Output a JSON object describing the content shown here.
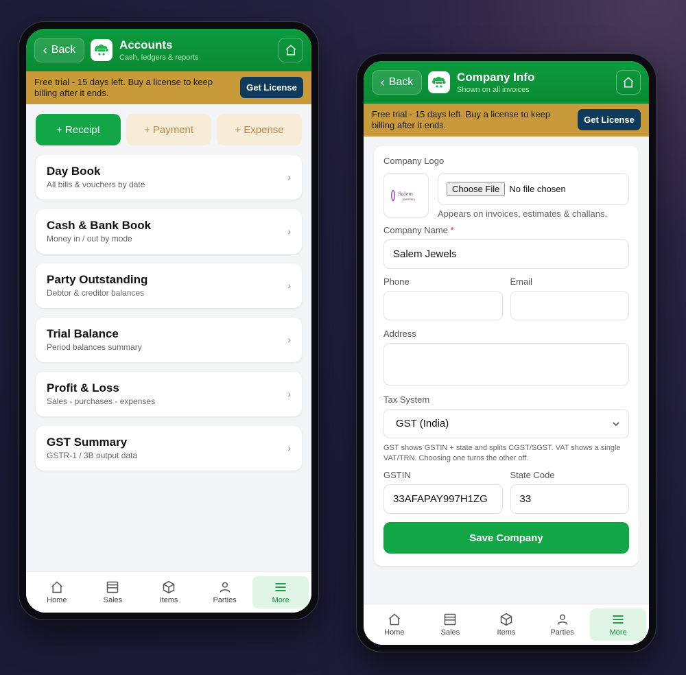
{
  "accounts": {
    "back_label": "Back",
    "title": "Accounts",
    "subtitle": "Cash, ledgers & reports",
    "trial_text": "Free trial - 15 days left. Buy a license to keep billing after it ends.",
    "license_label": "Get License",
    "actions": [
      {
        "label": "+ Receipt"
      },
      {
        "label": "+ Payment"
      },
      {
        "label": "+ Expense"
      }
    ],
    "menu": [
      {
        "title": "Day Book",
        "sub": "All bills & vouchers by date"
      },
      {
        "title": "Cash & Bank Book",
        "sub": "Money in / out by mode"
      },
      {
        "title": "Party Outstanding",
        "sub": "Debtor & creditor balances"
      },
      {
        "title": "Trial Balance",
        "sub": "Period balances summary"
      },
      {
        "title": "Profit & Loss",
        "sub": "Sales - purchases - expenses"
      },
      {
        "title": "GST Summary",
        "sub": "GSTR-1 / 3B output data"
      }
    ],
    "menu_chevron": "›"
  },
  "company": {
    "back_label": "Back",
    "title": "Company Info",
    "subtitle": "Shown on all invoices",
    "trial_text": "Free trial - 15 days left. Buy a license to keep billing after it ends.",
    "license_label": "Get License",
    "logo_label": "Company Logo",
    "logo_image_text": "Salem Jewellery",
    "choose_file_label": "Choose File",
    "no_file_text": "No file chosen",
    "logo_hint": "Appears on invoices, estimates & challans.",
    "name_label": "Company Name",
    "name_required": "*",
    "name_value": "Salem Jewels",
    "phone_label": "Phone",
    "phone_value": "",
    "email_label": "Email",
    "email_value": "",
    "address_label": "Address",
    "address_value": "",
    "tax_label": "Tax System",
    "tax_value": "GST (India)",
    "tax_note": "GST shows GSTIN + state and splits CGST/SGST. VAT shows a single VAT/TRN. Choosing one turns the other off.",
    "gstin_label": "GSTIN",
    "gstin_value": "33AFAPAY997H1ZG",
    "state_label": "State Code",
    "state_value": "33",
    "save_label": "Save Company"
  },
  "nav": [
    {
      "label": "Home",
      "icon": "home-icon"
    },
    {
      "label": "Sales",
      "icon": "sales-icon"
    },
    {
      "label": "Items",
      "icon": "box-icon"
    },
    {
      "label": "Parties",
      "icon": "user-icon"
    },
    {
      "label": "More",
      "icon": "menu-icon",
      "active": true
    }
  ],
  "colors": {
    "brand_green": "#0d9a3c",
    "trial_banner": "#c99a3a",
    "license_button": "#0e3a5c",
    "active_nav_bg": "#e1f5e6"
  }
}
